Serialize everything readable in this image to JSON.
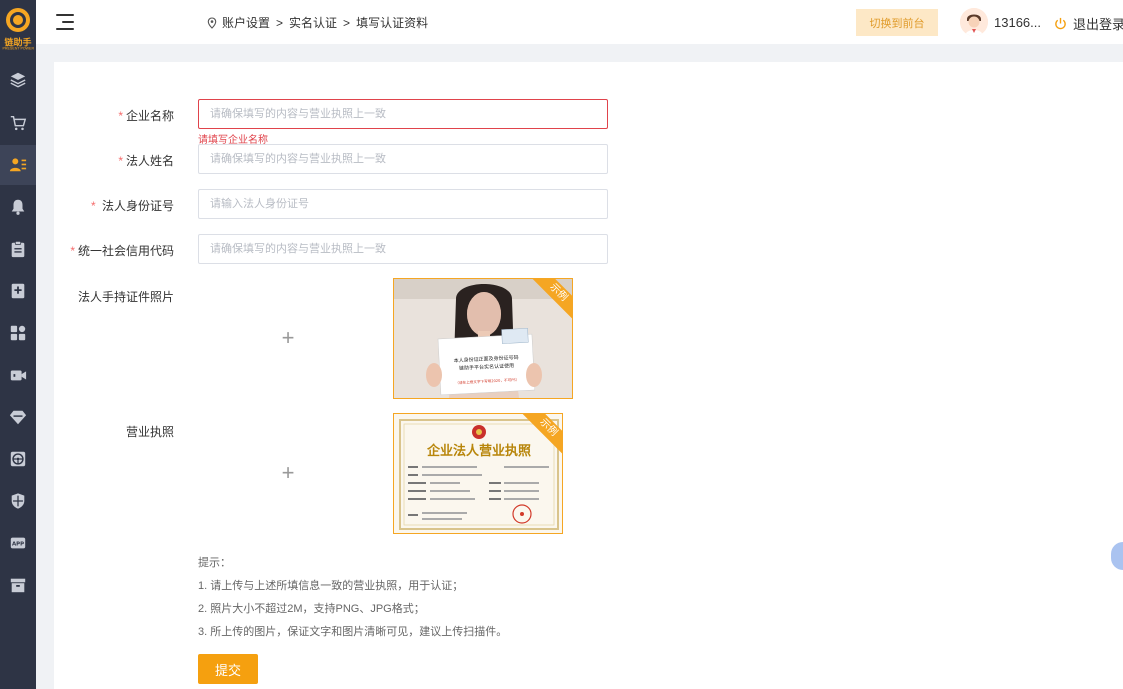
{
  "logo": {
    "text": "链助手",
    "sub": "PRESENT POWER"
  },
  "sidebar": {
    "icons": [
      "layers-icon",
      "cart-icon",
      "user-list-icon",
      "bell-icon",
      "clipboard-icon",
      "bookmark-icon",
      "grid-icon",
      "video-icon",
      "diamond-icon",
      "steering-wheel-icon",
      "shield-icon",
      "app-icon",
      "box-icon"
    ],
    "active_index": 2
  },
  "header": {
    "breadcrumb": [
      "账户设置",
      "实名认证",
      "填写认证资料"
    ],
    "breadcrumb_sep": ">",
    "switch_label": "切换到前台",
    "username": "13166...",
    "logout_label": "退出登录"
  },
  "form": {
    "company_name": {
      "label": "企业名称",
      "placeholder": "请确保填写的内容与营业执照上一致",
      "error": "请填写企业名称"
    },
    "legal_name": {
      "label": "法人姓名",
      "placeholder": "请确保填写的内容与营业执照上一致"
    },
    "legal_id": {
      "label": "法人身份证号",
      "placeholder": "请输入法人身份证号"
    },
    "credit_code": {
      "label": "统一社会信用代码",
      "placeholder": "请确保填写的内容与营业执照上一致"
    },
    "id_photo": {
      "label": "法人手持证件照片",
      "upload_icon": "+",
      "example_tag": "示例",
      "note_line1": "本人身份证正面及身份证号码",
      "note_line2": "链助手平台实名认证使用",
      "note_red": "（请在上框文字下写明2020，不可PS）"
    },
    "license": {
      "label": "营业执照",
      "upload_icon": "+",
      "example_tag": "示例",
      "license_title": "企业法人营业执照"
    }
  },
  "tips": {
    "title": "提示：",
    "items": [
      "1. 请上传与上述所填信息一致的营业执照，用于认证；",
      "2. 照片大小不超过2M，支持PNG、JPG格式；",
      "3. 所上传的图片，保证文字和图片清晰可见，建议上传扫描件。"
    ]
  },
  "submit_label": "提交",
  "colors": {
    "accent": "#f5a00f",
    "sidebar": "#2e3445",
    "error": "#e0434b"
  }
}
